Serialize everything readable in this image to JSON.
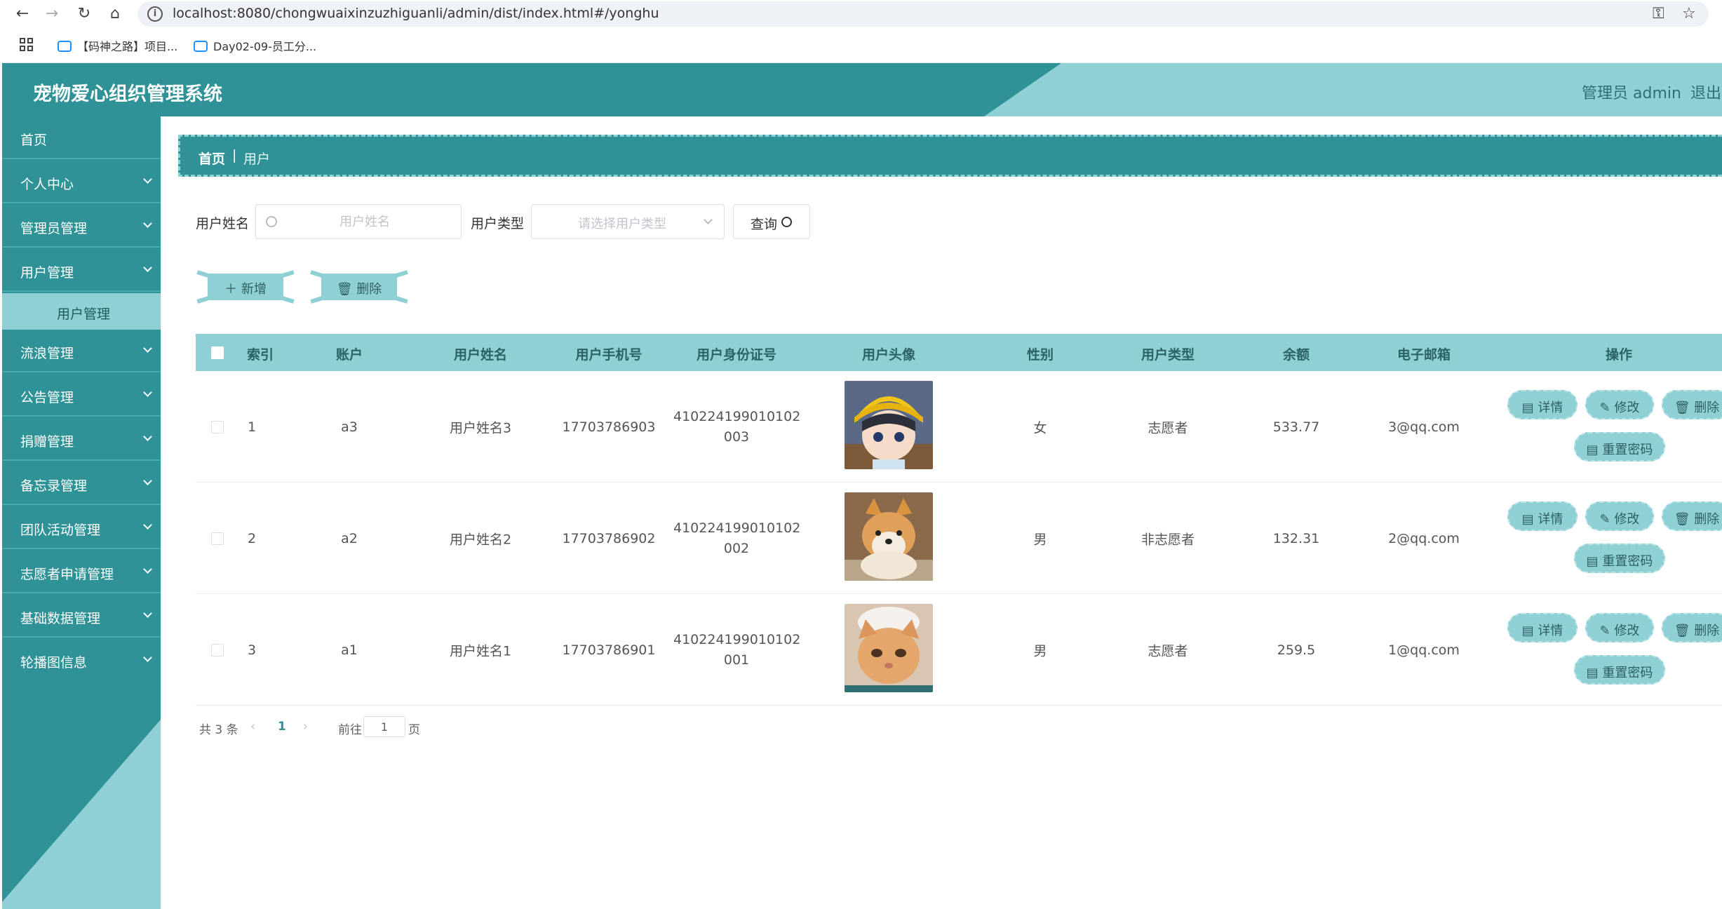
{
  "browser": {
    "url": "localhost:8080/chongwuaixinzuzhiguanli/admin/dist/index.html#/yonghu",
    "bookmarks": [
      "【码神之路】项目...",
      "Day02-09-员工分..."
    ]
  },
  "header": {
    "title": "宠物爱心组织管理系统",
    "user": "管理员 admin",
    "logout": "退出登录"
  },
  "sidebar": {
    "items": [
      {
        "label": "首页"
      },
      {
        "label": "个人中心"
      },
      {
        "label": "管理员管理"
      },
      {
        "label": "用户管理"
      },
      {
        "label": "流浪管理"
      },
      {
        "label": "公告管理"
      },
      {
        "label": "捐赠管理"
      },
      {
        "label": "备忘录管理"
      },
      {
        "label": "团队活动管理"
      },
      {
        "label": "志愿者申请管理"
      },
      {
        "label": "基础数据管理"
      },
      {
        "label": "轮播图信息"
      }
    ],
    "subitem": "用户管理"
  },
  "breadcrumb": {
    "home": "首页",
    "separator": "|",
    "current": "用户"
  },
  "search": {
    "name_label": "用户姓名",
    "name_placeholder": "用户姓名",
    "type_label": "用户类型",
    "type_placeholder": "请选择用户类型",
    "query_label": "查询"
  },
  "actions": {
    "add": "＋ 新增",
    "delete": "🗑 删除"
  },
  "table": {
    "columns": [
      "索引",
      "账户",
      "用户姓名",
      "用户手机号",
      "用户身份证号",
      "用户头像",
      "性别",
      "用户类型",
      "余额",
      "电子邮箱",
      "操作"
    ],
    "rows": [
      {
        "index": "1",
        "account": "a3",
        "name": "用户姓名3",
        "phone": "17703786903",
        "id_line1": "410224199010102",
        "id_line2": "003",
        "gender": "女",
        "type": "志愿者",
        "balance": "533.77",
        "email": "3@qq.com"
      },
      {
        "index": "2",
        "account": "a2",
        "name": "用户姓名2",
        "phone": "17703786902",
        "id_line1": "410224199010102",
        "id_line2": "002",
        "gender": "男",
        "type": "非志愿者",
        "balance": "132.31",
        "email": "2@qq.com"
      },
      {
        "index": "3",
        "account": "a1",
        "name": "用户姓名1",
        "phone": "17703786901",
        "id_line1": "410224199010102",
        "id_line2": "001",
        "gender": "男",
        "type": "志愿者",
        "balance": "259.5",
        "email": "1@qq.com"
      }
    ],
    "ops": {
      "detail": "详情",
      "edit": "修改",
      "delete": "删除",
      "reset": "重置密码"
    }
  },
  "pagination": {
    "total": "共 3 条",
    "current": "1",
    "goto": "前往",
    "goto_value": "1",
    "page": "页"
  },
  "colors": {
    "primary": "#2f9297",
    "accent": "#8fd0d4"
  }
}
